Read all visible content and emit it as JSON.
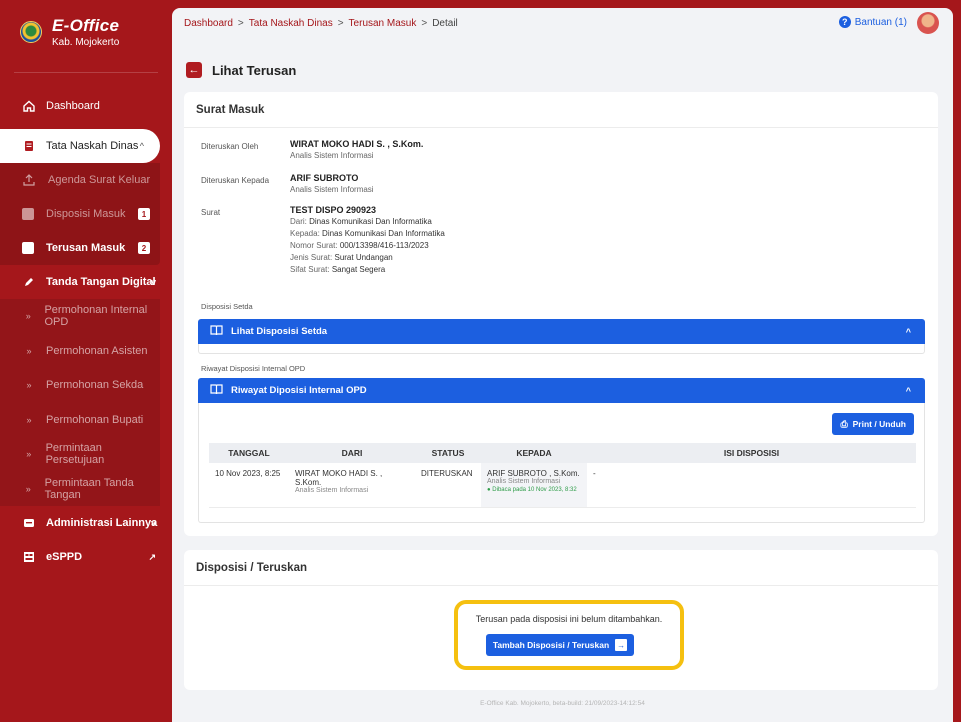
{
  "brand": {
    "title": "E-Office",
    "subtitle": "Kab. Mojokerto"
  },
  "sidebar": {
    "dashboard": "Dashboard",
    "tata_naskah": "Tata Naskah Dinas",
    "tata_sub": [
      {
        "label": "Agenda Surat Keluar",
        "badge": ""
      },
      {
        "label": "Disposisi Masuk",
        "badge": "1"
      },
      {
        "label": "Terusan Masuk",
        "badge": "2"
      }
    ],
    "ttd": "Tanda Tangan Digital",
    "ttd_sub": [
      "Permohonan Internal OPD",
      "Permohonan Asisten",
      "Permohonan Sekda",
      "Permohonan Bupati",
      "Permintaan Persetujuan",
      "Permintaan Tanda Tangan"
    ],
    "admin": "Administrasi Lainnya",
    "esppd": "eSPPD"
  },
  "breadcrumb": {
    "c1": "Dashboard",
    "c2": "Tata Naskah Dinas",
    "c3": "Terusan Masuk",
    "c4": "Detail",
    "sep": ">"
  },
  "help": "Bantuan (1)",
  "page_title": "Lihat Terusan",
  "surat_masuk": {
    "title": "Surat Masuk",
    "diteruskan_oleh_label": "Diteruskan Oleh",
    "diteruskan_oleh_name": "WIRAT MOKO HADI S. , S.Kom.",
    "diteruskan_oleh_role": "Analis Sistem Informasi",
    "diteruskan_kepada_label": "Diteruskan Kepada",
    "diteruskan_kepada_name": "ARIF SUBROTO",
    "diteruskan_kepada_role": "Analis Sistem Informasi",
    "surat_label": "Surat",
    "surat_title": "TEST DISPO 290923",
    "dari_label": "Dari:",
    "dari_val": "Dinas Komunikasi Dan Informatika",
    "kepada_label": "Kepada:",
    "kepada_val": "Dinas Komunikasi Dan Informatika",
    "nomor_label": "Nomor Surat:",
    "nomor_val": "000/13398/416-113/2023",
    "jenis_label": "Jenis Surat:",
    "jenis_val": "Surat Undangan",
    "sifat_label": "Sifat Surat:",
    "sifat_val": "Sangat Segera",
    "disposisi_setda_label": "Disposisi Setda",
    "disposisi_setda_bar": "Lihat Disposisi Setda",
    "riwayat_label": "Riwayat Disposisi Internal OPD",
    "riwayat_bar": "Riwayat Diposisi Internal OPD",
    "print": "Print / Unduh"
  },
  "table": {
    "headers": [
      "TANGGAL",
      "DARI",
      "STATUS",
      "KEPADA",
      "ISI DISPOSISI"
    ],
    "row": {
      "tanggal": "10 Nov 2023, 8:25",
      "dari_name": "WIRAT MOKO HADI S. , S.Kom.",
      "dari_role": "Analis Sistem Informasi",
      "status": "DITERUSKAN",
      "kepada_name": "ARIF SUBROTO , S.Kom.",
      "kepada_role": "Analis Sistem Informasi",
      "kepada_read": "Dibaca pada 10 Nov 2023, 8:32",
      "isi": "-"
    }
  },
  "disposisi": {
    "title": "Disposisi / Teruskan",
    "empty": "Terusan pada disposisi ini belum ditambahkan.",
    "add_button": "Tambah Disposisi / Teruskan"
  },
  "footer": "E-Office Kab. Mojokerto, beta-build: 21/09/2023-14:12:54",
  "colors": {
    "brand_red": "#a5171b",
    "primary_blue": "#1c5fe0",
    "highlight_yellow": "#f5c010",
    "read_green": "#2e9c48"
  }
}
